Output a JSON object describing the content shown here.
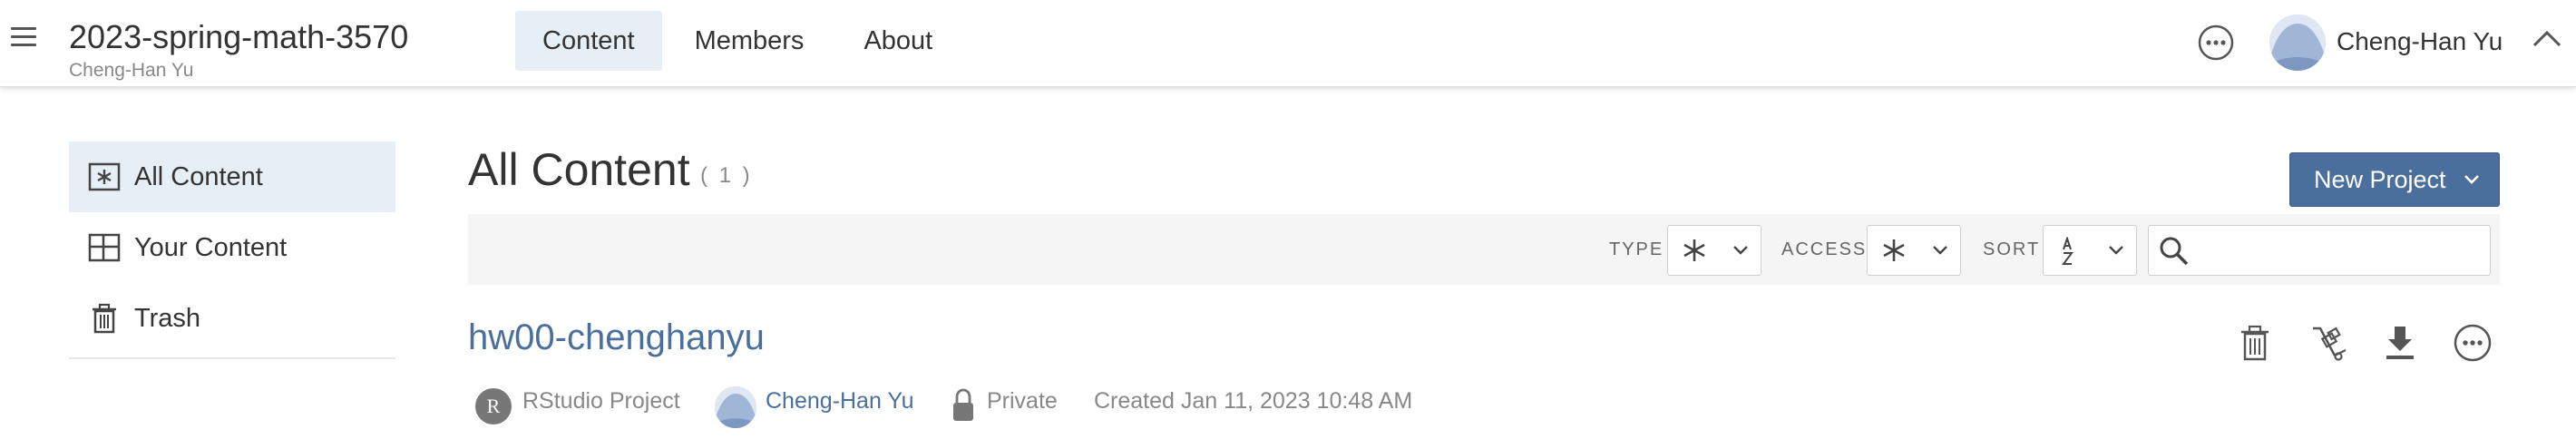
{
  "header": {
    "space_title": "2023-spring-math-3570",
    "space_owner": "Cheng-Han Yu",
    "tabs": [
      {
        "label": "Content",
        "active": true
      },
      {
        "label": "Members",
        "active": false
      },
      {
        "label": "About",
        "active": false
      }
    ],
    "user_name": "Cheng-Han Yu"
  },
  "sidebar": {
    "items": [
      {
        "label": "All Content",
        "icon": "asterisk-box-icon",
        "active": true
      },
      {
        "label": "Your Content",
        "icon": "layout-grid-icon",
        "active": false
      },
      {
        "label": "Trash",
        "icon": "trash-icon",
        "active": false
      }
    ]
  },
  "main": {
    "title": "All Content",
    "count": "( 1 )",
    "new_project_label": "New Project",
    "filters": {
      "type_label": "TYPE",
      "access_label": "ACCESS",
      "sort_label": "SORT",
      "search_placeholder": ""
    },
    "items": [
      {
        "title": "hw00-chenghanyu",
        "type_badge": "R",
        "type": "RStudio Project",
        "owner": "Cheng-Han Yu",
        "access": "Private",
        "created": "Created Jan 11, 2023 10:48 AM"
      }
    ]
  },
  "colors": {
    "accent": "#4b6f9d",
    "active_bg": "#e6eef6",
    "filter_bar_bg": "#f5f5f5",
    "muted_text": "#888888"
  }
}
